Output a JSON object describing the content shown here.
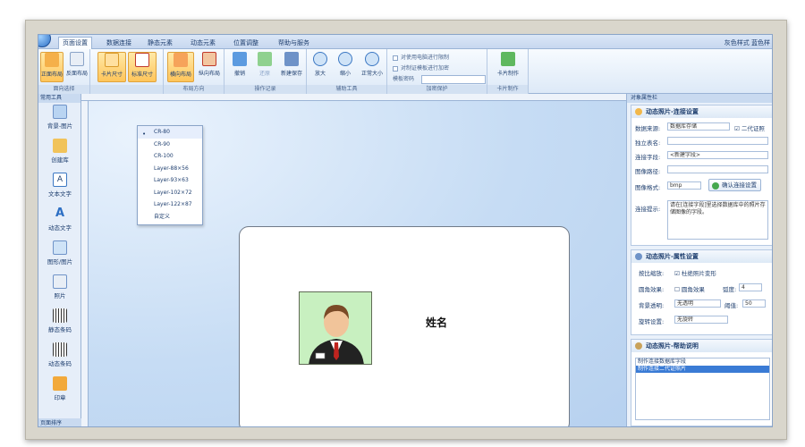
{
  "ribbon_tabs": [
    "页面设置",
    "数据连接",
    "静态元素",
    "动态元素",
    "位置调整",
    "帮助与服务"
  ],
  "style_links": "灰色样式  蓝色样",
  "groups": {
    "page_direction": {
      "label": "面向选择",
      "buttons": [
        "正面布局",
        "反面布局"
      ]
    },
    "size": {
      "label": "",
      "buttons": [
        "卡片尺寸",
        "标准尺寸"
      ]
    },
    "layout_direction": {
      "label": "布局方向",
      "buttons": [
        "横向布局",
        "纵向布局"
      ]
    },
    "operations": {
      "label": "操作记录",
      "buttons": [
        "撤销",
        "还原",
        "新建保存"
      ]
    },
    "assist": {
      "label": "辅助工具",
      "buttons": [
        "放大",
        "缩小",
        "正常大小"
      ]
    },
    "encrypt": {
      "label": "加密保护",
      "checks": [
        "对使用电脑进行限制",
        "对制证模板进行加密"
      ],
      "password_label": "模板密码"
    },
    "card": {
      "label": "卡片制作",
      "buttons": [
        "卡片制作"
      ]
    }
  },
  "size_menu": {
    "options": [
      "CR-80",
      "CR-90",
      "CR-100",
      "Layer-88×56",
      "Layer-93×63",
      "Layer-102×72",
      "Layer-122×87",
      "自定义"
    ],
    "selected": "CR-80"
  },
  "toolbox": {
    "title": "常用工具",
    "items": [
      "背景-图片",
      "创建库",
      "文本文字",
      "动态文字",
      "图形/图片",
      "照片",
      "静态条码",
      "动态条码",
      "印章"
    ],
    "footer": "页面排序"
  },
  "card": {
    "name_label": "姓名"
  },
  "right_panel": {
    "title": "对象属性栏",
    "connect": {
      "header": "动态照片-连接设置",
      "source_label": "数据来源:",
      "source_value": "数据库存储",
      "qr_label": "二代证照",
      "table_label": "独立表名:",
      "field_label": "连接字段:",
      "field_value": "<新建字段>",
      "path_label": "图像路径:",
      "format_label": "图像格式:",
      "format_value": "bmp",
      "confirm_button": "确认连接设置",
      "hint_label": "连接提示:",
      "hint_text": "请在[连接字段]里选择数据库中的照片存储图像的字段。"
    },
    "props": {
      "header": "动态照片-属性设置",
      "scale_label": "按比缩放:",
      "scale_check": "杜绝照片变形",
      "corner_label": "圆角效果:",
      "corner_check": "圆角效果",
      "radius_label": "弧度:",
      "radius_value": "4",
      "transparent_label": "背景透明:",
      "transparent_value": "无透明",
      "threshold_label": "阈值:",
      "threshold_value": "50",
      "rotate_label": "旋转设置:",
      "rotate_value": "无旋转"
    },
    "help": {
      "header": "动态照片-帮助说明",
      "lines": [
        "制作连接数据库字段",
        "制作连接二代证照片"
      ]
    }
  },
  "colors": {
    "accent": "#2d6fc4",
    "ribbon_bg": "#dde9f7",
    "canvas_bg": "#c6dcf4",
    "selected_btn": "#ffc55a"
  }
}
